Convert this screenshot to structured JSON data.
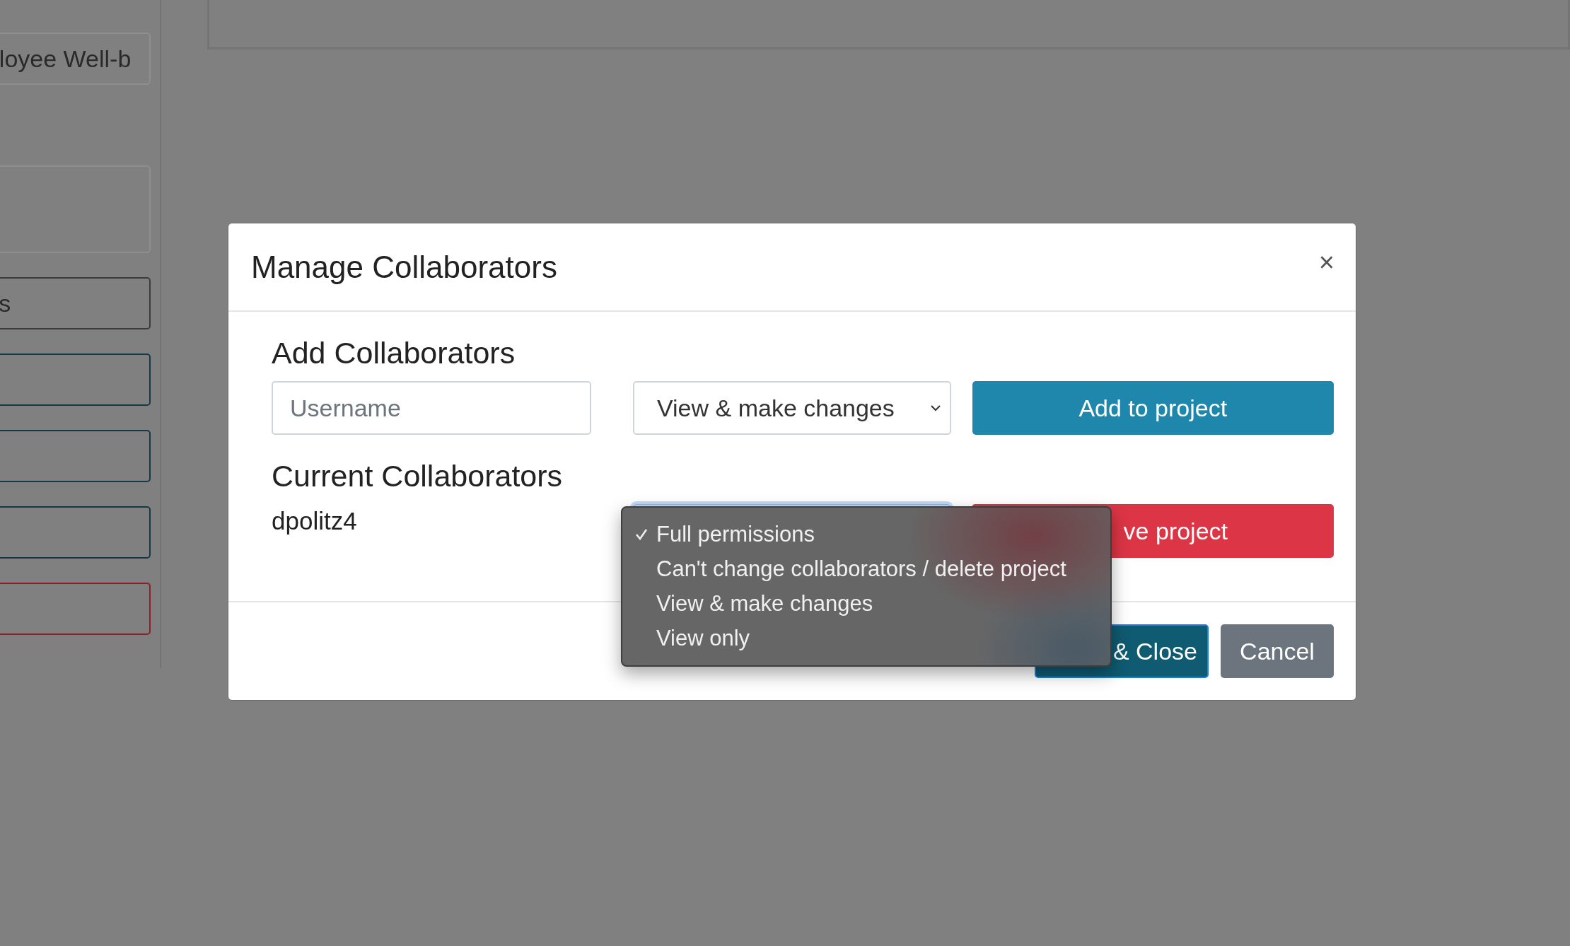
{
  "background": {
    "sidebar_items": [
      {
        "kind": "field",
        "text": "loyee Well-b"
      },
      {
        "kind": "area"
      },
      {
        "kind": "outline",
        "color": "#3c3c3c",
        "text": "s"
      },
      {
        "kind": "outline",
        "color": "#163a45"
      },
      {
        "kind": "outline",
        "color": "#163a45"
      },
      {
        "kind": "outline",
        "color": "#163a45"
      },
      {
        "kind": "outline",
        "color": "#8c1f2a"
      }
    ]
  },
  "modal": {
    "title": "Manage Collaborators",
    "close": "×",
    "add_heading": "Add Collaborators",
    "username": {
      "placeholder": "Username"
    },
    "permission_select": {
      "value": "View & make changes"
    },
    "add_button": "Add to project",
    "current_heading": "Current Collaborators",
    "collaborators": [
      {
        "username": "dpolitz4",
        "remove_button": "ve project"
      }
    ],
    "footer_buttons": [
      {
        "kind": "primary",
        "label": "& Close"
      },
      {
        "kind": "secondary",
        "label": "Cancel"
      }
    ]
  },
  "permission_menu": {
    "options": [
      {
        "label": "Full permissions",
        "selected": true
      },
      {
        "label": "Can't change collaborators / delete project",
        "selected": false
      },
      {
        "label": "View & make changes",
        "selected": false
      },
      {
        "label": "View only",
        "selected": false
      }
    ]
  }
}
